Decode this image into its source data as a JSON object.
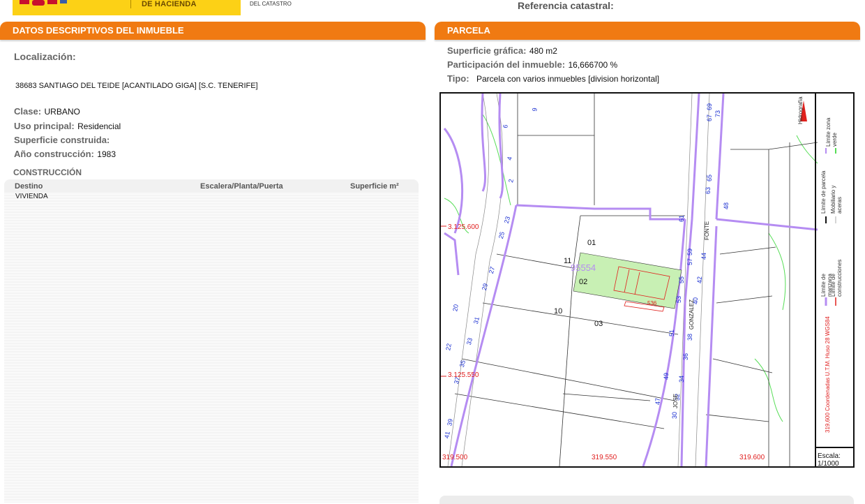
{
  "header": {
    "ministry": "DE HACIENDA",
    "office": "DEL CATASTRO",
    "ref_label": "Referencia catastral:"
  },
  "left": {
    "section_title": "DATOS DESCRIPTIVOS DEL INMUEBLE",
    "localizacion_label": "Localización:",
    "address": "38683 SANTIAGO DEL TEIDE [ACANTILADO GIGA] [S.C. TENERIFE]",
    "clase_label": "Clase:",
    "clase_value": "URBANO",
    "uso_label": "Uso principal:",
    "uso_value": "Residencial",
    "superficie_label": "Superficie construida:",
    "anio_label": "Año construcción:",
    "anio_value": "1983",
    "construccion_title": "CONSTRUCCIÓN",
    "table": {
      "headers": [
        "Destino",
        "Escalera/Planta/Puerta",
        "Superficie m²"
      ],
      "rows": [
        [
          "VIVIENDA",
          "",
          ""
        ]
      ]
    }
  },
  "right": {
    "section_title": "PARCELA",
    "sup_grafica_label": "Superficie gráfica:",
    "sup_grafica_value": "480 m2",
    "participacion_label": "Participación del inmueble:",
    "participacion_value": "16,666700 %",
    "tipo_label": "Tipo:",
    "tipo_value": "Parcela con varios inmuebles [division horizontal]"
  },
  "map": {
    "parcel_ref": "95554",
    "parcel_labels": [
      "01",
      "11",
      "02",
      "10",
      "03"
    ],
    "street_numbers": [
      "9",
      "6",
      "4",
      "2",
      "25",
      "23",
      "27",
      "29",
      "31",
      "33",
      "35",
      "37",
      "39",
      "41",
      "20",
      "22",
      "67",
      "69",
      "73",
      "65",
      "63",
      "59",
      "61",
      "57",
      "55",
      "53",
      "51",
      "49",
      "47",
      "48",
      "44",
      "42",
      "40",
      "38",
      "36",
      "34",
      "32",
      "30"
    ],
    "street_names": [
      "FONTE",
      "GONZALEZ",
      "JOSE"
    ],
    "y_coords": [
      "3.125.600",
      "3.125.550"
    ],
    "x_coords": [
      "319.500",
      "319.550",
      "319.600"
    ],
    "small_label": "536",
    "legend": {
      "hidrografia": "Hidrografía",
      "zona_verde": "Límite zona verde",
      "parcela": "Límite de parcela",
      "mobiliario": "Mobiliario y aceras",
      "manzana": "Límite de manzana",
      "construcciones": "Límite de construcciones",
      "coords": "319,600 Coordenadas U.T.M. Huso 28 WGS84"
    },
    "scale_label": "Escala:",
    "scale_value": "1/1000",
    "colors": {
      "manzana": "#b58cf2",
      "construcciones": "#e0201c",
      "parcel_fill": "#c8f0b4",
      "street_num": "#1a2fd1",
      "coord": "#e02020",
      "green": "#55dd55"
    }
  }
}
